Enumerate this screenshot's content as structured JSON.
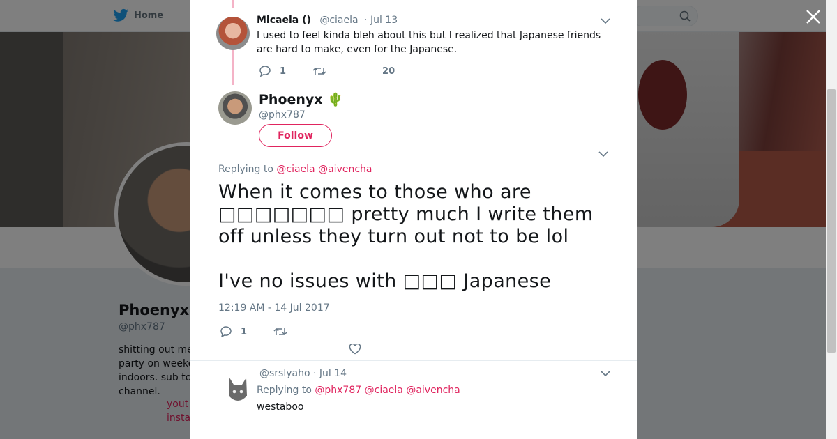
{
  "nav": {
    "home_label": "Home"
  },
  "background_profile": {
    "name": "Phoenyx",
    "handle": "@phx787",
    "bio_lines": [
      "shitting out me",
      "party on weeke",
      "indoors. sub to",
      "channel."
    ],
    "links": [
      "yout",
      "insta"
    ]
  },
  "parent_tweet": {
    "name": "Micaela ()",
    "handle": "@ciaela",
    "date": "· Jul 13",
    "text": "I used to feel kinda bleh about this but I realized that Japanese friends are hard to make, even for the Japanese.",
    "reply_count": "1",
    "like_count": "20"
  },
  "main_tweet": {
    "name": "Phoenyx",
    "emoji": "🌵",
    "handle": "@phx787",
    "follow_label": "Follow",
    "replying_prefix": "Replying to",
    "mentions": [
      "@ciaela",
      "@aivencha"
    ],
    "text_line1": "When it comes to those who are □□□□□□□ pretty much I write them off unless they turn out not to be lol",
    "text_line2": "I've no issues with □□□ Japanese",
    "timestamp": "12:19 AM - 14 Jul 2017",
    "reply_count": "1"
  },
  "reply_tweet": {
    "handle": "@srslyaho",
    "date": "· Jul 14",
    "replying_prefix": "Replying to",
    "mentions": [
      "@phx787",
      "@ciaela",
      "@aivencha"
    ],
    "text": "westaboo"
  },
  "colors": {
    "accent": "#e0245e",
    "twitter_blue": "#1da1f2",
    "muted": "#657786"
  }
}
